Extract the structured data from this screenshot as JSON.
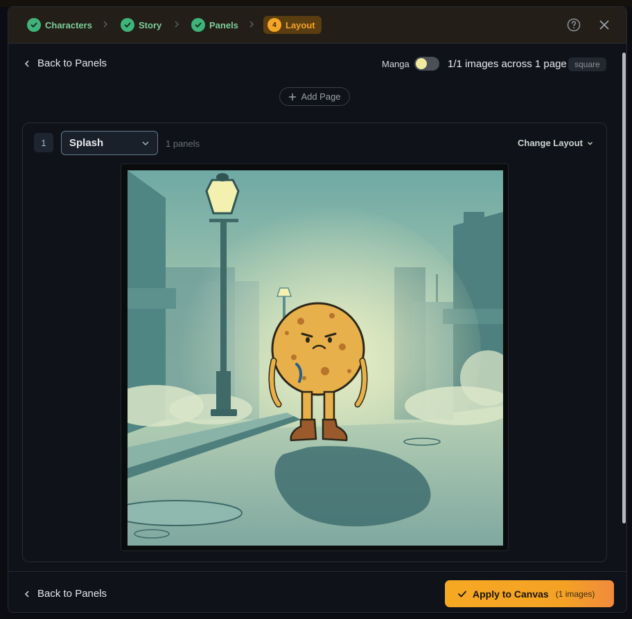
{
  "steps": [
    {
      "label": "Characters",
      "state": "done"
    },
    {
      "label": "Story",
      "state": "done"
    },
    {
      "label": "Panels",
      "state": "done"
    },
    {
      "label": "Layout",
      "state": "current",
      "number": "4"
    }
  ],
  "header": {
    "help_icon": "help-circle-icon",
    "close_icon": "close-icon"
  },
  "toolbar": {
    "back_label": "Back to Panels",
    "manga_label": "Manga",
    "manga_enabled": false,
    "count_text": "1/1 images across 1 page",
    "aspect_tag": "square",
    "add_page_label": "Add Page"
  },
  "page": {
    "number": "1",
    "layout_value": "Splash",
    "panels_text": "1 panels",
    "change_layout_label": "Change Layout"
  },
  "footer": {
    "back_label": "Back to Panels",
    "apply_label": "Apply to Canvas",
    "apply_count": "(1 images)"
  },
  "colors": {
    "accent": "#f5a524",
    "done": "#3fb37a",
    "background": "#0f1218"
  }
}
